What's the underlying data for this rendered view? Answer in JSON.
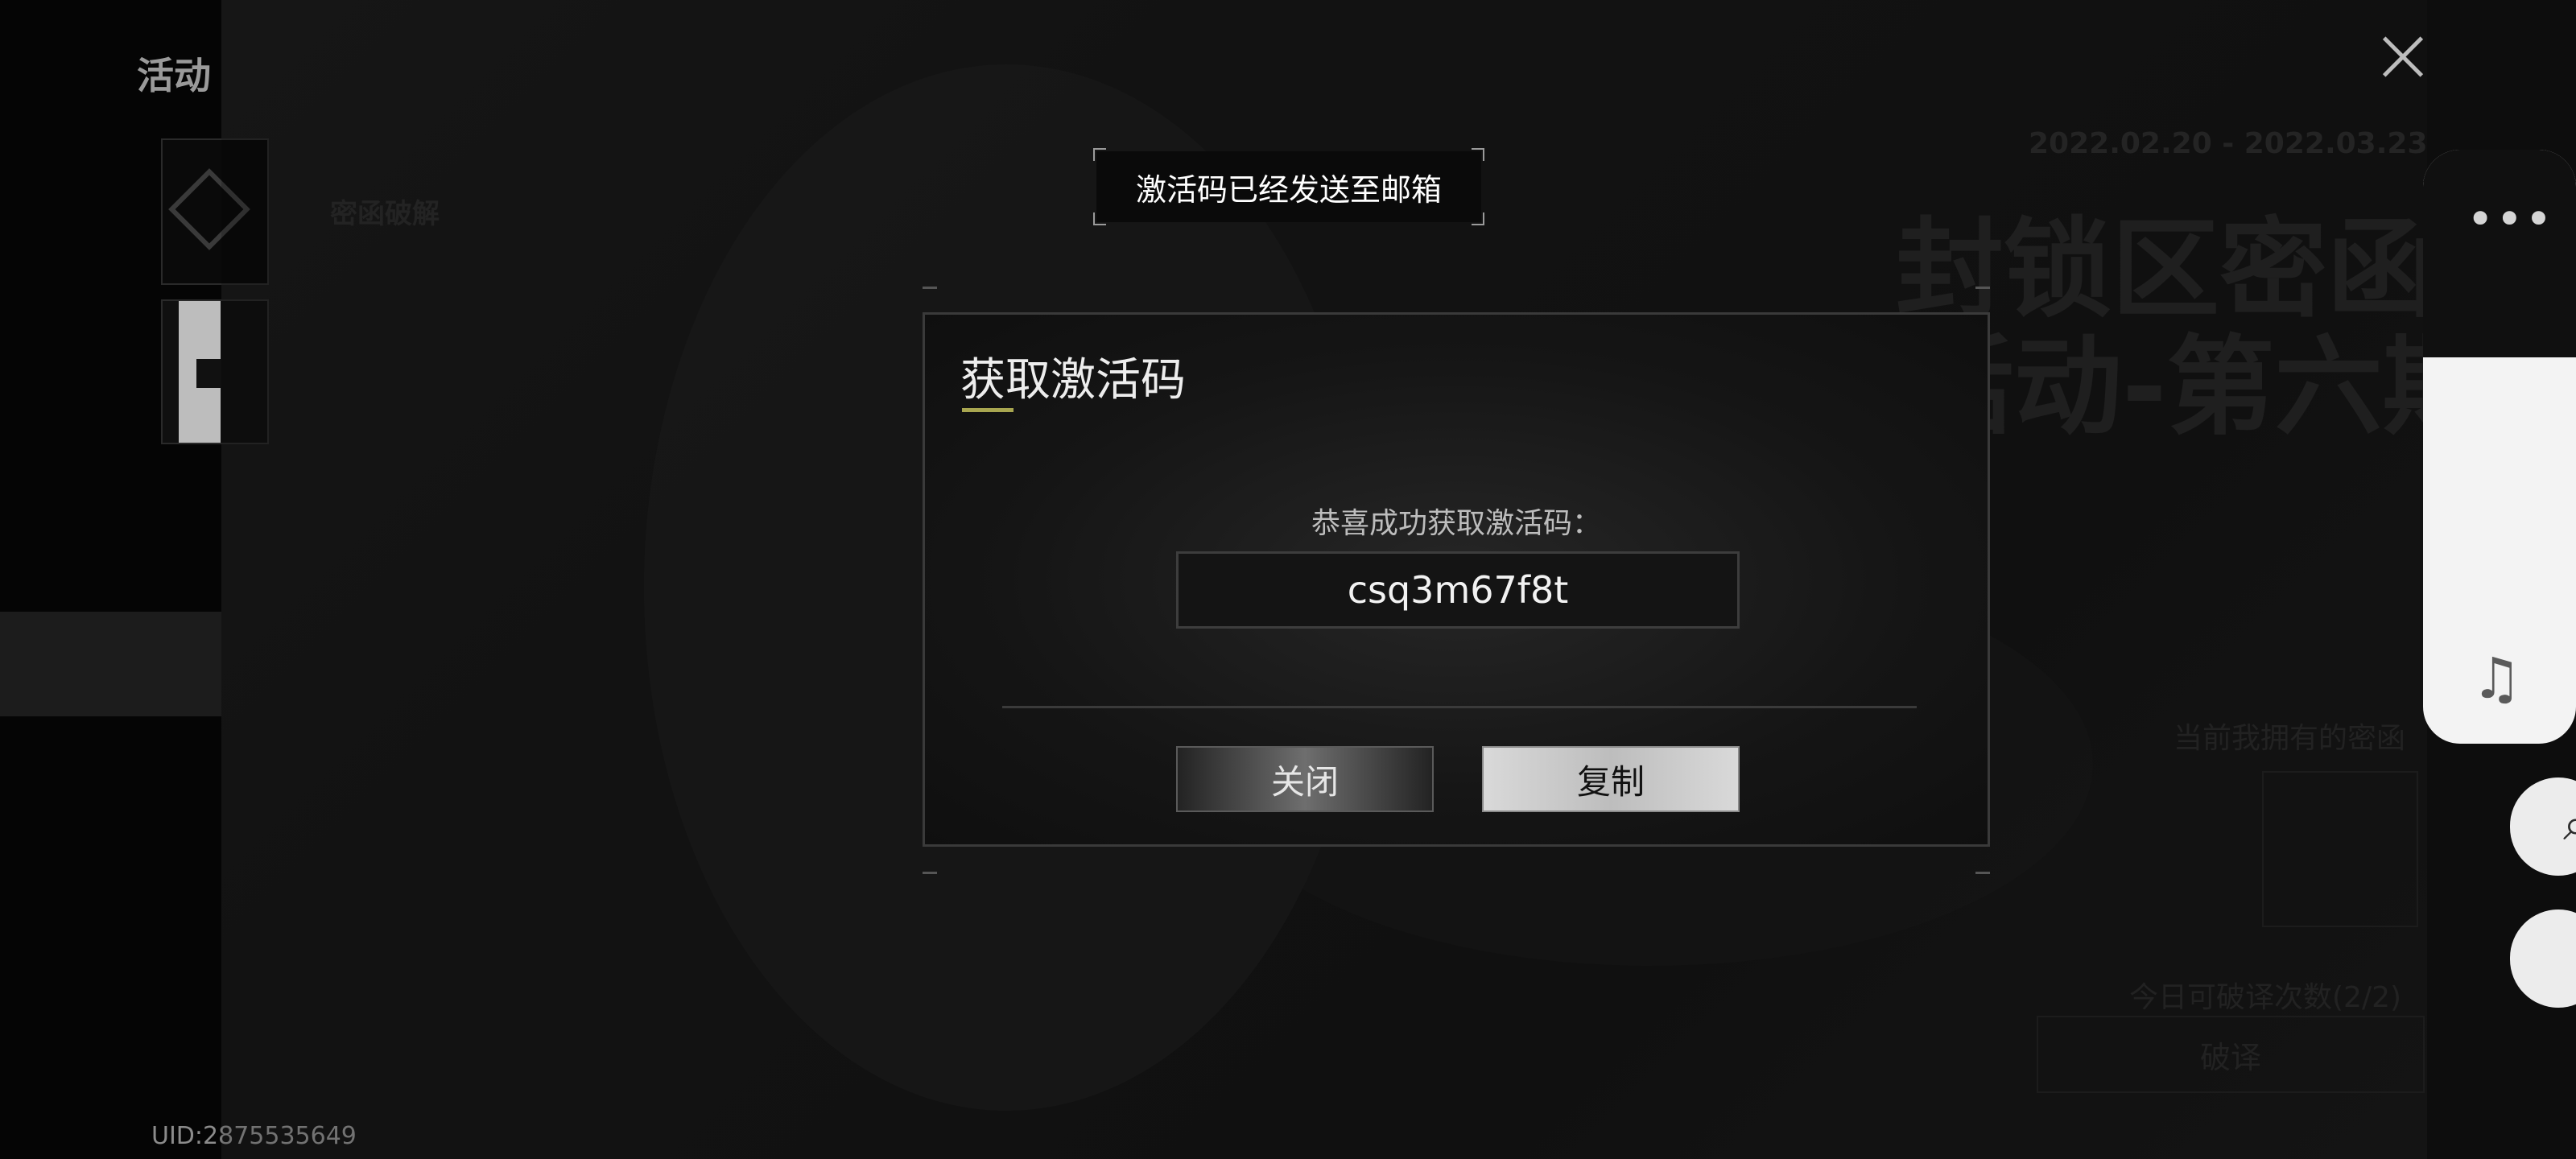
{
  "app": {
    "page_title": "活动",
    "uid_text": "UID:2875535649"
  },
  "background": {
    "menu_item_active": "密函破解",
    "date_range": "2022.02.20 - 2022.03.23",
    "event_title_line1": "封锁区密函",
    "event_title_line2": "破译活动-第六期",
    "owned_label": "当前我拥有的密函",
    "attempts_label": "今日可破译次数(2/2)",
    "decode_button": "破译"
  },
  "toast": {
    "message": "激活码已经发送至邮箱"
  },
  "dialog": {
    "title": "获取激活码",
    "success_label": "恭喜成功获取激活码：",
    "code": "csq3m67f8t",
    "close_label": "关闭",
    "copy_label": "复制"
  },
  "float_panel": {
    "menu_icon": "more-dots-icon",
    "music_icon": "music-note-icon",
    "colors": {
      "panel": "#f3f3f3",
      "panel_top": "#101010"
    }
  },
  "icons": {
    "close": "close-icon",
    "cube": "cube-icon",
    "info": "info-icon"
  },
  "colors": {
    "accent_underline": "#a8a650",
    "dialog_bg": "#111111",
    "copy_button": "#cfcfcf"
  }
}
